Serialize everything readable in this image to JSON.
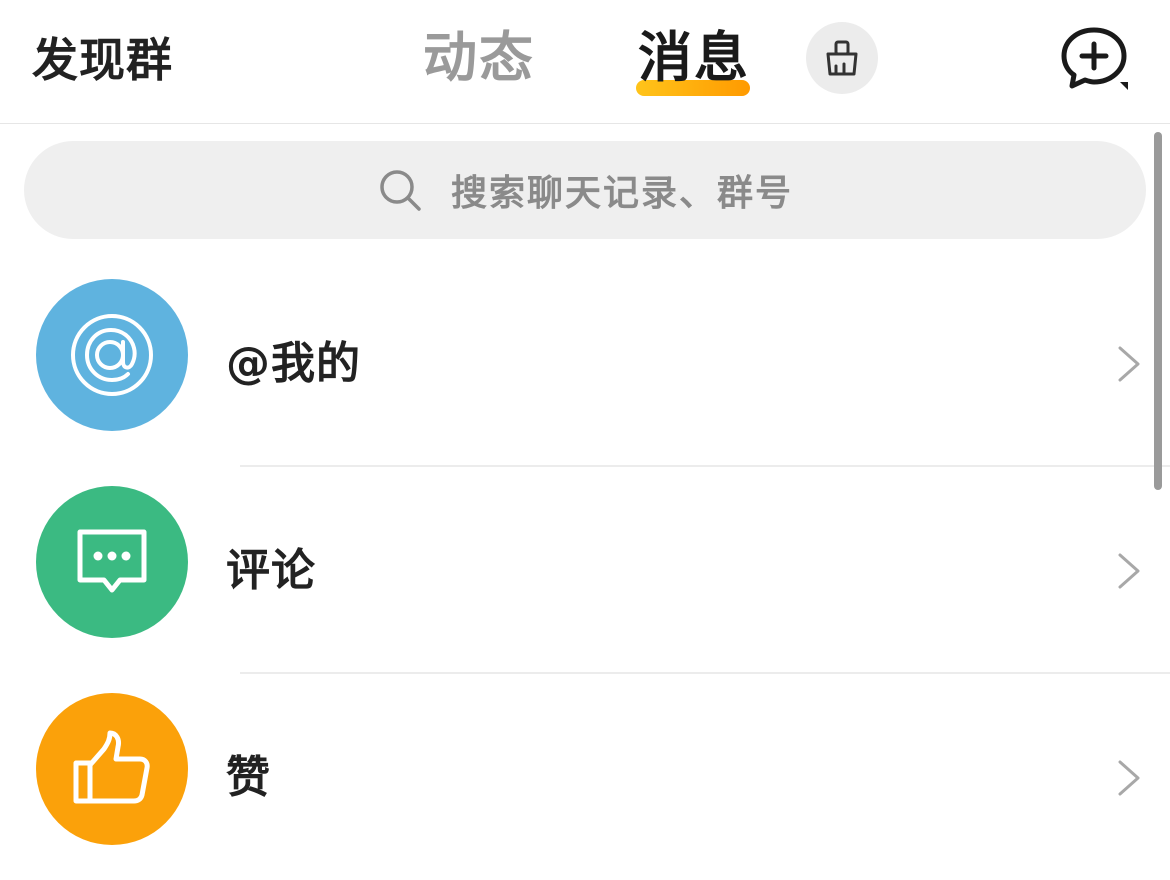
{
  "header": {
    "discover_label": "发现群",
    "tabs": [
      {
        "label": "动态",
        "active": false
      },
      {
        "label": "消息",
        "active": true
      }
    ],
    "clean_icon": "broom-icon",
    "compose_icon": "add-chat-icon"
  },
  "search": {
    "placeholder": "搜索聊天记录、群号",
    "icon": "search-icon"
  },
  "list": {
    "items": [
      {
        "label": "@我的",
        "icon": "at-icon",
        "color": "#5fb3df"
      },
      {
        "label": "评论",
        "icon": "comment-icon",
        "color": "#3bba82"
      },
      {
        "label": "赞",
        "icon": "thumbs-up-icon",
        "color": "#fba10a"
      }
    ]
  },
  "colors": {
    "accent": "#ffb300",
    "tab_inactive": "#9a9a9a"
  }
}
